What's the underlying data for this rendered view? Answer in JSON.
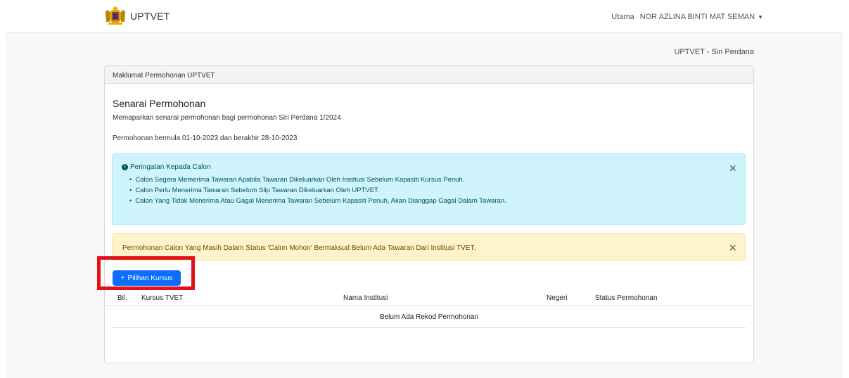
{
  "navbar": {
    "brand": "UPTVET",
    "links": [
      "Utama",
      "NOR AZLINA BINTI MAT SEMAN"
    ],
    "user_caret_icon": "caret-down-icon"
  },
  "siri_label": "UPTVET - Siri Perdana",
  "card": {
    "header": "Maklumat Permohonan UPTVET",
    "title": "Senarai Permohonan",
    "description": "Memaparkan senarai permohonan bagi permohonan Siri Perdana 1/2024",
    "period": "Permohonan bermula 01-10-2023 dan berakhir 28-10-2023"
  },
  "alert_info": {
    "title": "Peringatan Kepada Calon",
    "items": [
      "Calon Segera Memerima Tawaran Apabila Tawaran Dikeluarkan Oleh Institusi Sebelum Kapasiti Kursus Penuh.",
      "Calon Perlu Menerima Tawaran Sebelum Slip Tawaran Dikeluarkan Oleh UPTVET.",
      "Calon Yang Tidak Menerima Atau Gagal Menerima Tawaran Sebelum Kapasiti Penuh, Akan Dianggap Gagal Dalam Tawaran."
    ],
    "close": "×"
  },
  "alert_warning": {
    "text": "Permohonan Calon Yang Masih Dalam Status 'Calon Mohon' Bermaksud Belum Ada Tawaran Dari Institusi TVET.",
    "close": "×"
  },
  "add_button": {
    "icon": "+",
    "label": "Pilihan Kursus"
  },
  "table": {
    "headers": [
      "Bil.",
      "Kursus TVET",
      "Nama Institusi",
      "Negeri",
      "Status Permohonan"
    ],
    "empty_text": "Belum Ada Rekod Permohonan"
  },
  "colors": {
    "primary": "#0d6efd",
    "info_bg": "#cff4fc",
    "warning_bg": "#fff3cd",
    "highlight": "#e3111a"
  }
}
